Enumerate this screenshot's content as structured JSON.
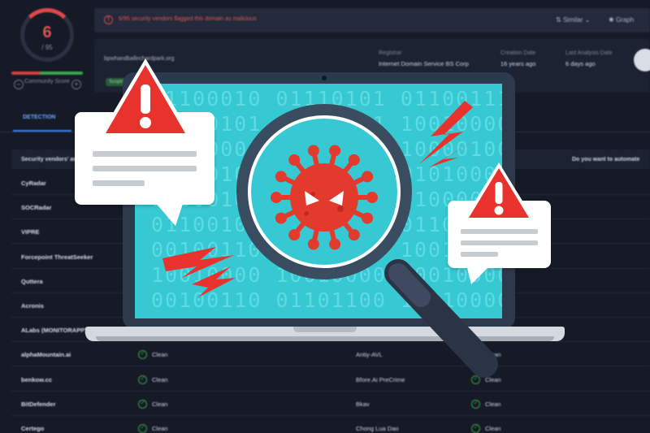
{
  "score": {
    "value": "6",
    "total": "/ 95"
  },
  "community": {
    "label": "Community Score",
    "down_icon": "minus-circle-icon",
    "up_icon": "plus-circle-icon"
  },
  "alert": {
    "text": "6/95 security vendors flagged this domain as malicious",
    "icon": "alert-circle-icon"
  },
  "top_actions": {
    "similar": "Similar",
    "graph": "Graph"
  },
  "domain": {
    "name": "bpwhandballechardpark.org",
    "tag": "Suspicious",
    "registrar_label": "Registrar",
    "registrar_value": "Internet Domain Service BS Corp",
    "creation_label": "Creation Date",
    "creation_value": "16 years ago",
    "last_analysis_label": "Last Analysis Date",
    "last_analysis_value": "6 days ago"
  },
  "tabs": {
    "detection": "DETECTION"
  },
  "table": {
    "header_vendors": "Security vendors' analysis",
    "header_automate": "Do you want to automate",
    "rows": [
      {
        "vendor": "CyRadar",
        "result": "",
        "vendor2": "",
        "result2": ""
      },
      {
        "vendor": "SOCRadar",
        "result": "",
        "vendor2": "",
        "result2": ""
      },
      {
        "vendor": "VIPRE",
        "result": "",
        "vendor2": "",
        "result2": ""
      },
      {
        "vendor": "Forcepoint ThreatSeeker",
        "result": "",
        "vendor2": "",
        "result2": ""
      },
      {
        "vendor": "Quttera",
        "result": "",
        "vendor2": "",
        "result2": ""
      },
      {
        "vendor": "Acronis",
        "result": "",
        "vendor2": "",
        "result2": ""
      },
      {
        "vendor": "ALabs (MONITORAPP)",
        "result": "",
        "vendor2": "",
        "result2": ""
      },
      {
        "vendor": "alphaMountain.ai",
        "result": "Clean",
        "vendor2": "Antiy-AVL",
        "result2": "Clean"
      },
      {
        "vendor": "benkow.cc",
        "result": "Clean",
        "vendor2": "Bfore.Ai PreCrime",
        "result2": "Clean"
      },
      {
        "vendor": "BitDefender",
        "result": "Clean",
        "vendor2": "Bkav",
        "result2": "Clean"
      },
      {
        "vendor": "Certego",
        "result": "Clean",
        "vendor2": "Chong Lua Dao",
        "result2": "Clean"
      }
    ]
  },
  "illustration": {
    "binary_lines": [
      "01100010  01110101  01100111",
      "10000101  01000101  10010000",
      "10010001  01001010  10000100",
      "10000100  10000110  01010000",
      "10000100  10000110  01000000",
      "01100100  01100101  01100100",
      "00100110  01101100  10010000",
      "10010000  10010000  10010000",
      "00100110  01101100  10010000"
    ],
    "colors": {
      "warning": "#e8322d",
      "screen": "#37c9d3",
      "virus": "#e23b2e",
      "lens_rim": "#2b3445"
    },
    "icons": [
      "warning-triangle-icon",
      "virus-icon",
      "magnifier-icon",
      "lightning-bolt-icon"
    ]
  }
}
